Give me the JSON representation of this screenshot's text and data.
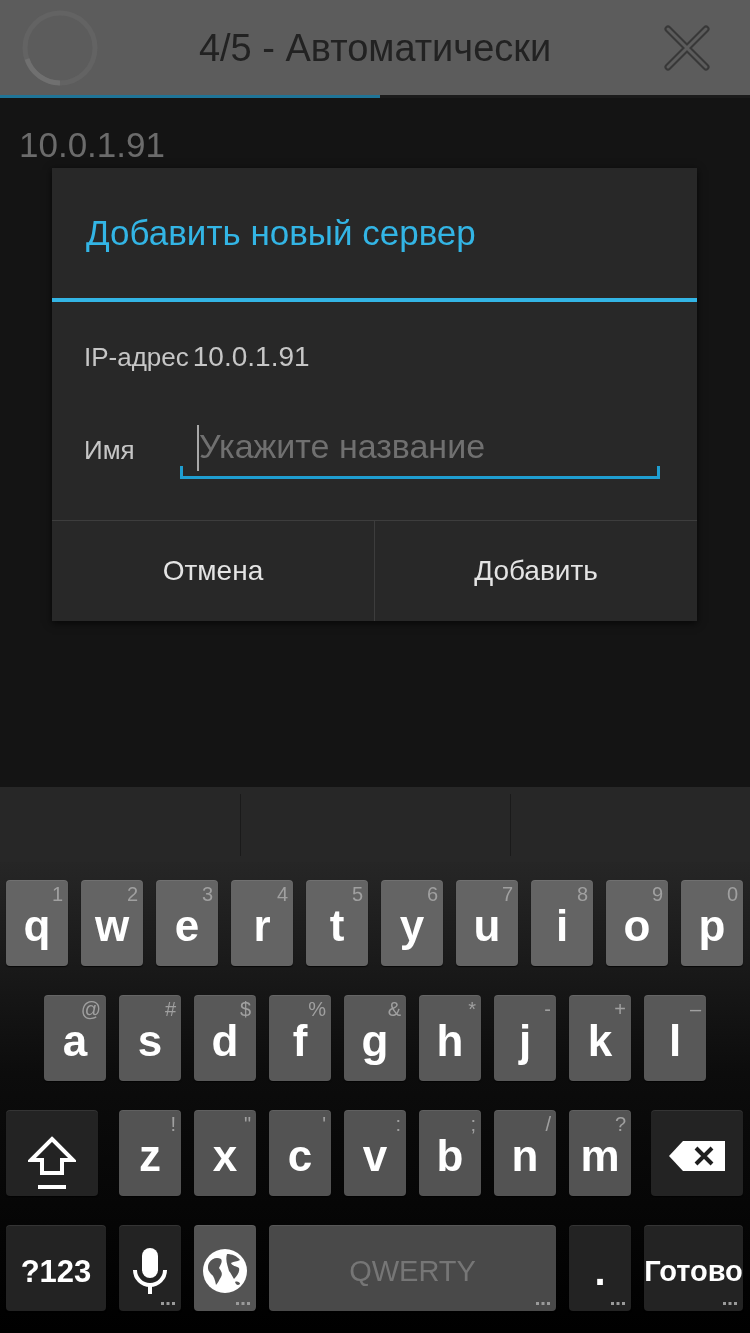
{
  "action_bar": {
    "title": "4/5 - Автоматически",
    "progress": {
      "level": 0.507
    }
  },
  "server_list": [
    {
      "address": "10.0.1.91"
    }
  ],
  "dialog": {
    "title": "Добавить новый сервер",
    "fields": [
      {
        "kind": "static",
        "label": "IP-адрес",
        "value": "10.0.1.91"
      },
      {
        "kind": "input",
        "label": "Имя",
        "placeholder": "Укажите название",
        "focused": true
      }
    ],
    "buttons": [
      "Отмена",
      "Добавить"
    ]
  },
  "keyboard": {
    "rows": [
      {
        "keys": [
          {
            "kind": "letter",
            "label": "q",
            "hint": "1"
          },
          {
            "kind": "letter",
            "label": "w",
            "hint": "2"
          },
          {
            "kind": "letter",
            "label": "e",
            "hint": "3"
          },
          {
            "kind": "letter",
            "label": "r",
            "hint": "4"
          },
          {
            "kind": "letter",
            "label": "t",
            "hint": "5"
          },
          {
            "kind": "letter",
            "label": "y",
            "hint": "6"
          },
          {
            "kind": "letter",
            "label": "u",
            "hint": "7"
          },
          {
            "kind": "letter",
            "label": "i",
            "hint": "8"
          },
          {
            "kind": "letter",
            "label": "o",
            "hint": "9"
          },
          {
            "kind": "letter",
            "label": "p",
            "hint": "0"
          }
        ]
      },
      {
        "keys": [
          {
            "kind": "letter",
            "label": "a",
            "hint": "@"
          },
          {
            "kind": "letter",
            "label": "s",
            "hint": "#"
          },
          {
            "kind": "letter",
            "label": "d",
            "hint": "$"
          },
          {
            "kind": "letter",
            "label": "f",
            "hint": "%"
          },
          {
            "kind": "letter",
            "label": "g",
            "hint": "&"
          },
          {
            "kind": "letter",
            "label": "h",
            "hint": "*"
          },
          {
            "kind": "letter",
            "label": "j",
            "hint": "-"
          },
          {
            "kind": "letter",
            "label": "k",
            "hint": "+"
          },
          {
            "kind": "letter",
            "label": "l",
            "hint": "–"
          }
        ]
      },
      {
        "keys": [
          {
            "kind": "shift"
          },
          {
            "kind": "letter",
            "label": "z",
            "hint": "!"
          },
          {
            "kind": "letter",
            "label": "x",
            "hint": "\""
          },
          {
            "kind": "letter",
            "label": "c",
            "hint": "'"
          },
          {
            "kind": "letter",
            "label": "v",
            "hint": ":"
          },
          {
            "kind": "letter",
            "label": "b",
            "hint": ";"
          },
          {
            "kind": "letter",
            "label": "n",
            "hint": "/"
          },
          {
            "kind": "letter",
            "label": "m",
            "hint": "?"
          },
          {
            "kind": "backspace"
          }
        ]
      },
      {
        "keys": [
          {
            "kind": "symbols",
            "label": "?123",
            "more": false
          },
          {
            "kind": "mic",
            "more": true
          },
          {
            "kind": "globe",
            "more": true
          },
          {
            "kind": "space",
            "label": "QWERTY",
            "more": true
          },
          {
            "kind": "period",
            "label": ".",
            "more": true
          },
          {
            "kind": "done",
            "label": "Готово",
            "more": true
          }
        ]
      }
    ]
  }
}
